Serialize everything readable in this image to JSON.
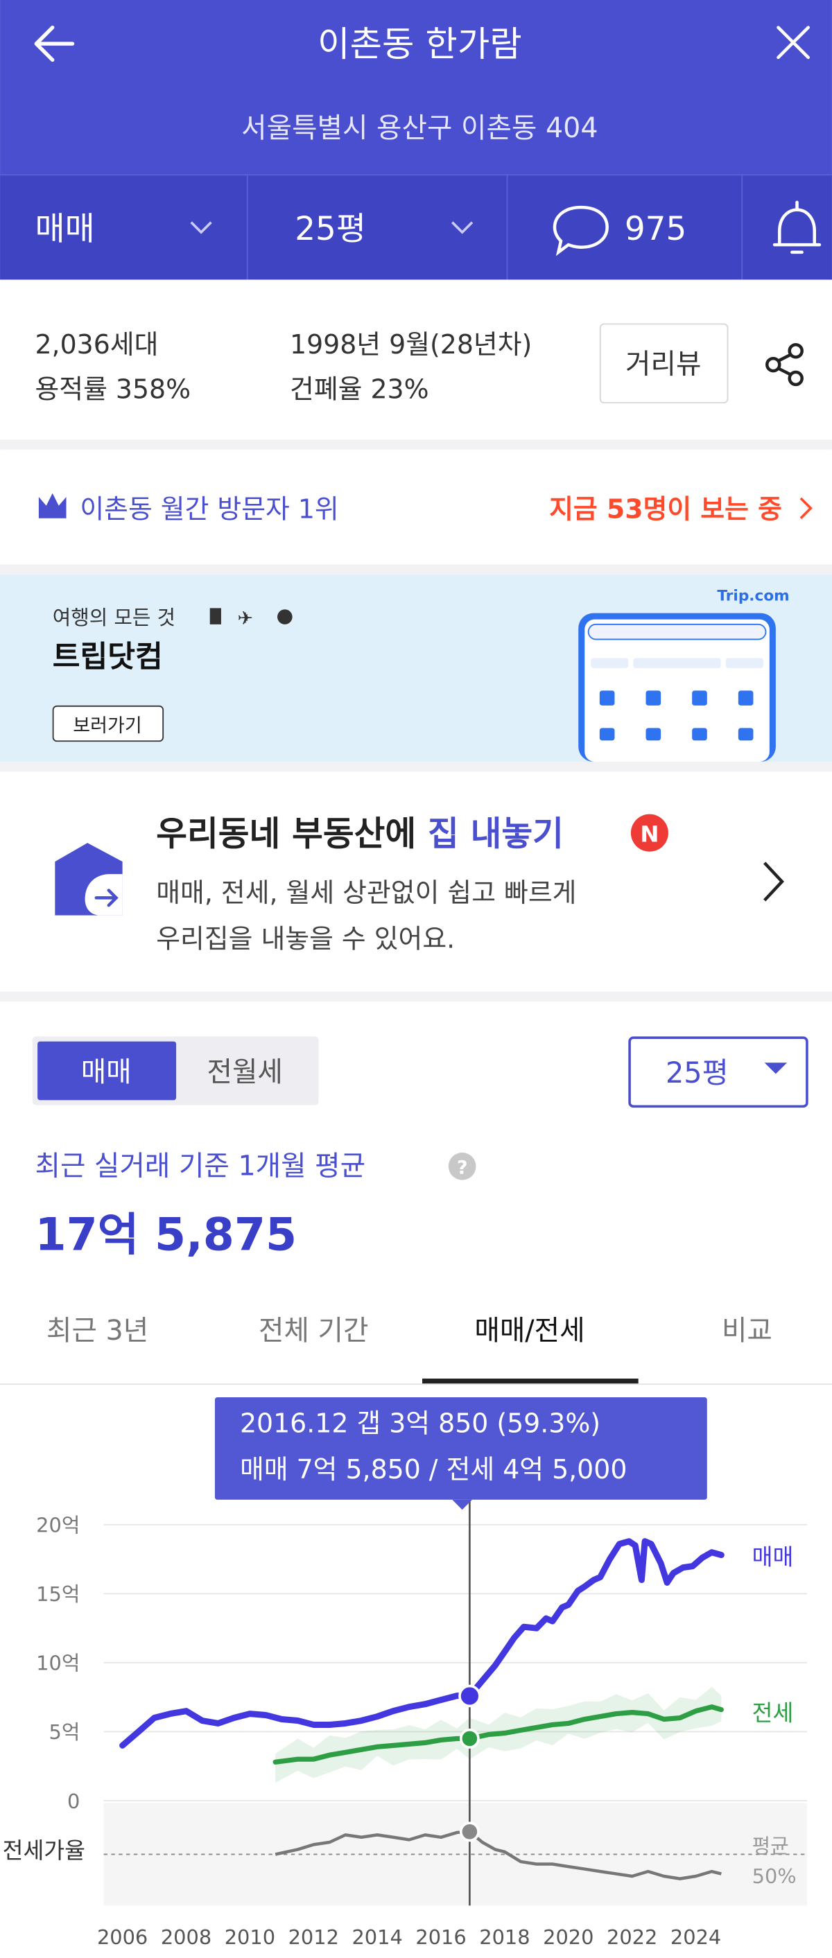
{
  "header": {
    "title": "이촌동 한가람",
    "address": "서울특별시 용산구 이촌동 404",
    "trade_type": "매매",
    "size": "25평",
    "comment_count": "975"
  },
  "info": {
    "households": "2,036세대",
    "built": "1998년 9월(28년차)",
    "floor_area_ratio": "용적률 358%",
    "coverage_ratio": "건폐율 23%",
    "street_view_label": "거리뷰"
  },
  "ranking": {
    "text": "이촌동 월간 방문자 1위",
    "live_viewers": "지금 53명이 보는 중"
  },
  "ad": {
    "tagline": "여행의 모든 것",
    "brand": "트립닷컴",
    "cta": "보러가기",
    "logo_text": "Trip.com"
  },
  "listing_promo": {
    "title_prefix": "우리동네 부동산에 ",
    "title_highlight": "집 내놓기",
    "badge": "N",
    "line1": "매매, 전세, 월세 상관없이 쉽고 빠르게",
    "line2": "우리집을 내놓을 수 있어요."
  },
  "price": {
    "toggle_sale": "매매",
    "toggle_rent": "전월세",
    "size_select": "25평",
    "basis_label": "최근 실거래 기준 1개월 평균",
    "value": "17억 5,875"
  },
  "tabs": [
    {
      "label": "최근 3년",
      "active": false
    },
    {
      "label": "전체 기간",
      "active": false
    },
    {
      "label": "매매/전세",
      "active": true
    },
    {
      "label": "비교",
      "active": false
    }
  ],
  "tooltip": {
    "line1": "2016.12  갭 3억 850 (59.3%)",
    "line2": "매매 7억 5,850 / 전세 4억 5,000"
  },
  "colors": {
    "brand": "#4a4fcf",
    "sale": "#4338e0",
    "jeonse": "#2e9e45",
    "accent": "#ff4b2b"
  },
  "chart_data": {
    "type": "line",
    "y_unit": "억",
    "ylim": [
      0,
      20
    ],
    "y_ticks": [
      "20억",
      "15억",
      "10억",
      "5억",
      "0"
    ],
    "x_ticks": [
      "2006",
      "2008",
      "2010",
      "2012",
      "2014",
      "2016",
      "2018",
      "2020",
      "2022",
      "2024"
    ],
    "series": [
      {
        "name": "매매",
        "color": "#4338e0",
        "x": [
          2006.0,
          2006.5,
          2007.0,
          2007.5,
          2008.0,
          2008.5,
          2009.0,
          2009.5,
          2010.0,
          2010.5,
          2011.0,
          2011.5,
          2012.0,
          2012.5,
          2013.0,
          2013.5,
          2014.0,
          2014.5,
          2015.0,
          2015.5,
          2016.0,
          2016.5,
          2016.9,
          2017.3,
          2017.7,
          2018.0,
          2018.3,
          2018.6,
          2019.0,
          2019.3,
          2019.5,
          2019.8,
          2020.0,
          2020.3,
          2020.5,
          2020.8,
          2021.0,
          2021.3,
          2021.6,
          2021.9,
          2022.1,
          2022.3,
          2022.4,
          2022.6,
          2022.9,
          2023.1,
          2023.3,
          2023.6,
          2023.9,
          2024.2,
          2024.5,
          2024.8
        ],
        "y": [
          4.0,
          5.0,
          6.0,
          6.3,
          6.5,
          5.8,
          5.6,
          6.0,
          6.3,
          6.2,
          5.9,
          5.8,
          5.5,
          5.5,
          5.6,
          5.8,
          6.1,
          6.5,
          6.8,
          7.0,
          7.3,
          7.6,
          7.6,
          8.7,
          9.8,
          10.8,
          11.8,
          12.6,
          12.5,
          13.2,
          13.0,
          14.0,
          14.2,
          15.2,
          15.5,
          16.0,
          16.2,
          17.5,
          18.6,
          18.8,
          18.5,
          16.0,
          18.8,
          18.6,
          17.2,
          15.8,
          16.5,
          16.9,
          17.0,
          17.6,
          18.0,
          17.8
        ]
      },
      {
        "name": "전세",
        "color": "#2e9e45",
        "x": [
          2010.8,
          2011.5,
          2012.0,
          2012.5,
          2013.0,
          2013.5,
          2014.0,
          2014.5,
          2015.0,
          2015.5,
          2016.0,
          2016.5,
          2016.9,
          2017.5,
          2018.0,
          2018.5,
          2019.0,
          2019.5,
          2020.0,
          2020.5,
          2021.0,
          2021.5,
          2022.0,
          2022.5,
          2023.0,
          2023.5,
          2024.0,
          2024.5,
          2024.8
        ],
        "y": [
          2.8,
          3.0,
          3.0,
          3.3,
          3.5,
          3.7,
          3.9,
          4.0,
          4.1,
          4.2,
          4.4,
          4.5,
          4.5,
          4.8,
          4.9,
          5.1,
          5.3,
          5.5,
          5.6,
          5.9,
          6.1,
          6.3,
          6.4,
          6.3,
          5.9,
          6.0,
          6.5,
          6.8,
          6.6
        ]
      }
    ],
    "highlight": {
      "x": 2016.9,
      "sale": 7.585,
      "jeonse": 4.5,
      "gap": 3.085,
      "gap_pct": 59.3
    },
    "ratio_panel": {
      "label": "전세가율",
      "avg_label_line1": "평균",
      "avg_label_line2": "50%",
      "avg": 50,
      "x": [
        2010.8,
        2011.5,
        2012.0,
        2012.5,
        2013.0,
        2013.5,
        2014.0,
        2014.5,
        2015.0,
        2015.5,
        2016.0,
        2016.5,
        2016.9,
        2017.3,
        2017.7,
        2018.0,
        2018.5,
        2019.0,
        2019.5,
        2020.0,
        2020.5,
        2021.0,
        2021.5,
        2022.0,
        2022.5,
        2023.0,
        2023.5,
        2024.0,
        2024.5,
        2024.8
      ],
      "y": [
        50,
        52,
        54,
        55,
        58,
        57,
        58,
        57,
        56,
        58,
        57,
        59,
        59.3,
        55,
        52,
        51,
        47,
        46,
        46,
        45,
        44,
        43,
        42,
        41,
        43,
        41,
        40,
        41,
        43,
        42
      ]
    }
  }
}
